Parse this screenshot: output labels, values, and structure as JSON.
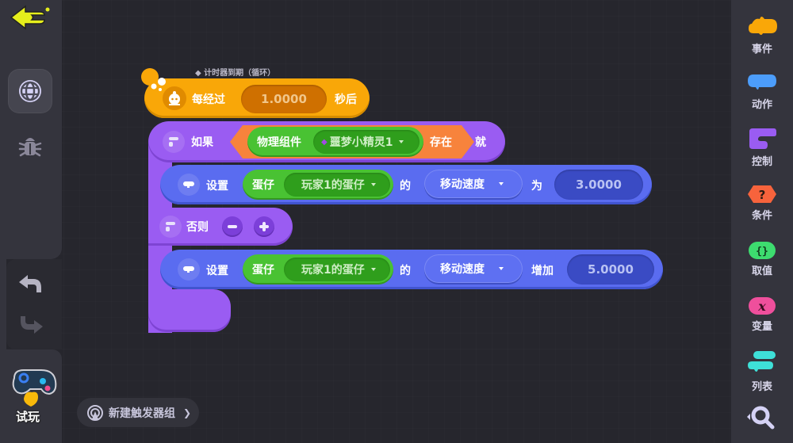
{
  "left_sidebar": {
    "back_icon": "arrow-left-icon",
    "world_icon": "globe-icon",
    "debug_icon": "bug-icon",
    "undo_icon": "undo-icon",
    "redo_icon": "redo-icon",
    "play_label": "试玩"
  },
  "new_trigger_group": {
    "label": "新建触发器组"
  },
  "right_sidebar": {
    "categories": [
      {
        "label": "事件",
        "color": "#f9a708"
      },
      {
        "label": "动作",
        "color": "#4c9dfb"
      },
      {
        "label": "控制",
        "color": "#9a5cf2"
      },
      {
        "label": "条件",
        "color": "#f7633c"
      },
      {
        "label": "取值",
        "color": "#3ddc6f"
      },
      {
        "label": "变量",
        "color": "#ef4f9c"
      },
      {
        "label": "列表",
        "color": "#3ee0d8"
      }
    ],
    "search_icon": "zoom-search-icon"
  },
  "script": {
    "event": {
      "caption": "◆ 计时器到期（循环）",
      "prefix": "每经过",
      "value": "1.0000",
      "suffix": "秒后"
    },
    "if_block": {
      "if_label": "如果",
      "condition": {
        "component_label": "物理组件",
        "target": "噩梦小精灵1",
        "exists_label": "存在"
      },
      "then_label": "就"
    },
    "set_block_1": {
      "label": "设置",
      "object_label": "蛋仔",
      "object_value": "玩家1的蛋仔",
      "of_label": "的",
      "property": "移动速度",
      "op_label": "为",
      "value": "3.0000"
    },
    "else_block": {
      "label": "否则"
    },
    "set_block_2": {
      "label": "设置",
      "object_label": "蛋仔",
      "object_value": "玩家1的蛋仔",
      "of_label": "的",
      "property": "移动速度",
      "op_label": "增加",
      "value": "5.0000"
    }
  }
}
